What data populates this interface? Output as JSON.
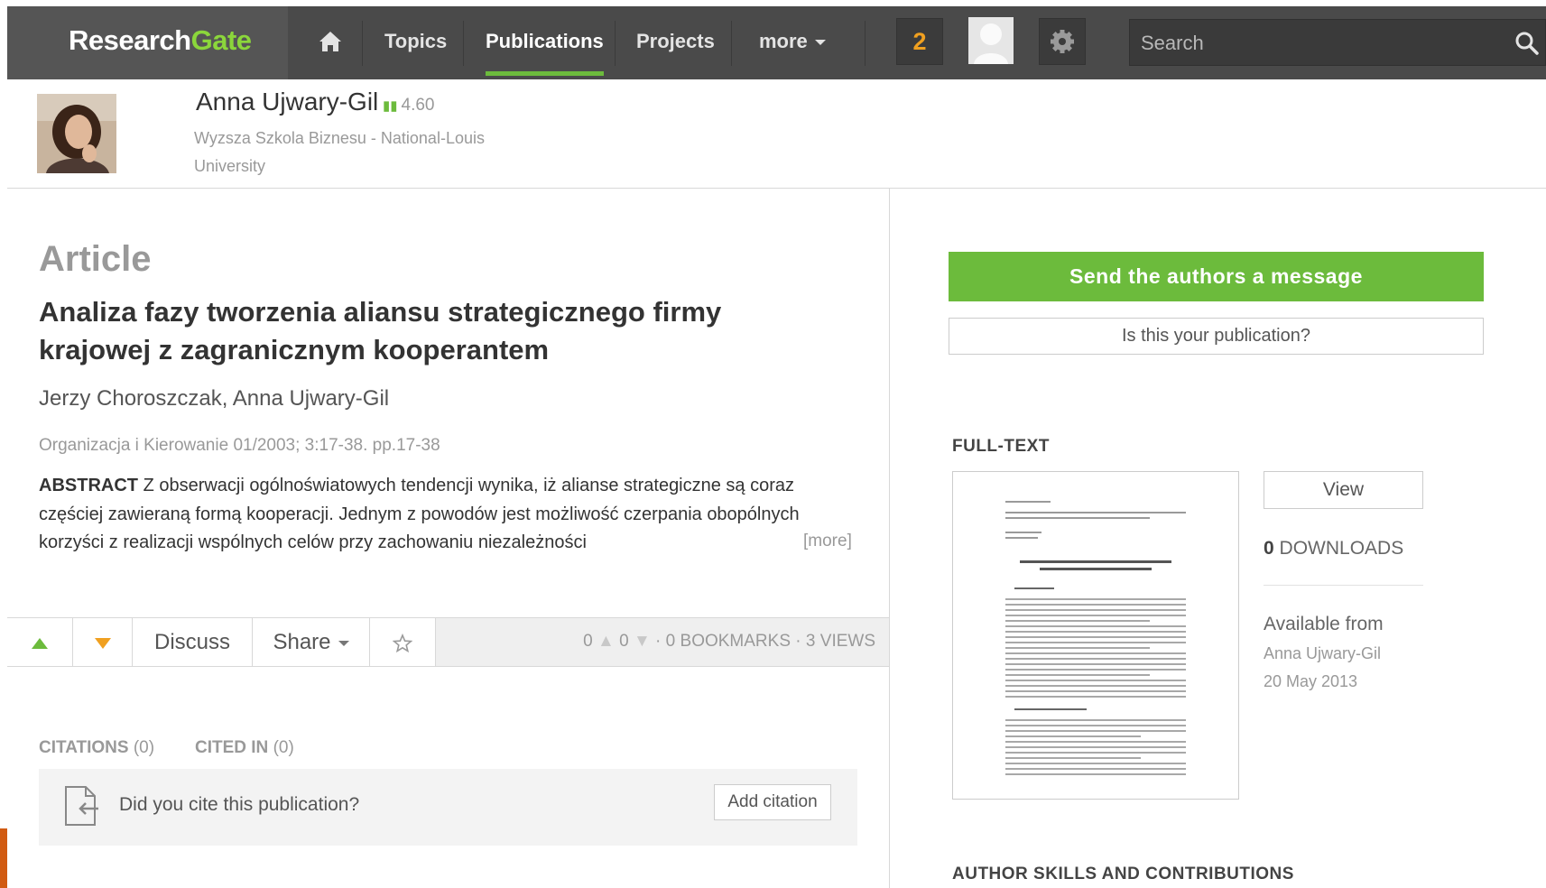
{
  "nav": {
    "logo_a": "Research",
    "logo_b": "Gate",
    "items": [
      "Topics",
      "Publications",
      "Projects",
      "more"
    ],
    "active": "Publications",
    "notification_count": "2",
    "search_placeholder": "Search",
    "icons": [
      "home-icon",
      "user-avatar",
      "gear-icon",
      "search-icon"
    ]
  },
  "profile": {
    "name": "Anna Ujwary-Gil",
    "score": "4.60",
    "institution": "Wyzsza Szkola Biznesu - National-Louis University"
  },
  "article": {
    "type": "Article",
    "title": "Analiza fazy tworzenia aliansu strategicznego firmy krajowej z zagranicznym kooperantem",
    "authors": "Jerzy Choroszczak, Anna Ujwary-Gil",
    "journal": "Organizacja i Kierowanie 01/2003; 3:17-38. pp.17-38",
    "abstract_label": "ABSTRACT",
    "abstract_text": "Z obserwacji ogólnoświatowych tendencji wynika, iż alianse strategiczne są coraz częściej zawieraną formą kooperacji. Jednym z powodów jest możliwość czerpania obopólnych korzyści z realizacji wspólnych celów przy zachowaniu niezależności",
    "more": "[more]"
  },
  "actions": {
    "discuss": "Discuss",
    "share": "Share",
    "upvotes": "0",
    "downvotes": "0",
    "bookmarks": "0",
    "bookmarks_label": "BOOKMARKS",
    "views": "3",
    "views_label": "VIEWS"
  },
  "citations": {
    "tab_citations": "CITATIONS",
    "citations_count": "(0)",
    "tab_cited_in": "CITED IN",
    "cited_in_count": "(0)",
    "prompt": "Did you cite this publication?",
    "add_button": "Add citation"
  },
  "sidebar": {
    "send_message": "Send the authors a message",
    "is_yours": "Is this your publication?",
    "fulltext_heading": "FULL-TEXT",
    "view_button": "View",
    "downloads_count": "0",
    "downloads_label": "DOWNLOADS",
    "available_from": "Available from",
    "available_by": "Anna Ujwary-Gil",
    "available_date": "20 May 2013",
    "skills_heading": "AUTHOR SKILLS AND CONTRIBUTIONS"
  },
  "colors": {
    "nav_bg": "#4a4a4a",
    "accent_green": "#6cbb3c",
    "notification_orange": "#f0a020",
    "muted_text": "#999999"
  }
}
